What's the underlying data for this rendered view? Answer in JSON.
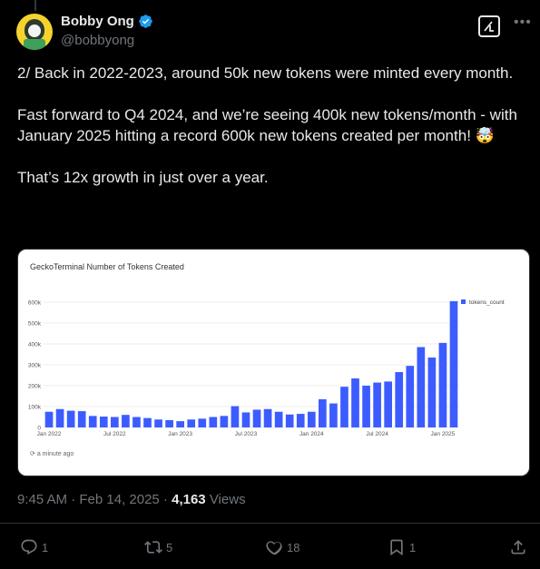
{
  "author": {
    "display_name": "Bobby Ong",
    "handle": "@bobbyong"
  },
  "tweet": {
    "text": "2/ Back in 2022-2023, around 50k new tokens were minted every month.\n\nFast forward to Q4 2024, and we’re seeing 400k new tokens/month - with January 2025 hitting a record 600k new tokens created per month! 🤯\n\nThat’s 12x growth in just over a year."
  },
  "chart_card": {
    "footer": "a minute ago"
  },
  "chart_data": {
    "type": "bar",
    "title": "GeckoTerminal Number of Tokens Created",
    "legend": "top-right",
    "grid": true,
    "xlabel": "",
    "ylabel": "",
    "ylim": [
      0,
      600000
    ],
    "y_ticks": [
      "0",
      "100k",
      "200k",
      "300k",
      "400k",
      "500k",
      "600k"
    ],
    "x_ticks": [
      "Jan 2022",
      "Jul 2022",
      "Jan 2023",
      "Jul 2023",
      "Jan 2024",
      "Jul 2024",
      "Jan 2025"
    ],
    "colors": {
      "bar": "#3d5cff"
    },
    "categories": [
      "Jan 2022",
      "Feb 2022",
      "Mar 2022",
      "Apr 2022",
      "May 2022",
      "Jun 2022",
      "Jul 2022",
      "Aug 2022",
      "Sep 2022",
      "Oct 2022",
      "Nov 2022",
      "Dec 2022",
      "Jan 2023",
      "Feb 2023",
      "Mar 2023",
      "Apr 2023",
      "May 2023",
      "Jun 2023",
      "Jul 2023",
      "Aug 2023",
      "Sep 2023",
      "Oct 2023",
      "Nov 2023",
      "Dec 2023",
      "Jan 2024",
      "Feb 2024",
      "Mar 2024",
      "Apr 2024",
      "May 2024",
      "Jun 2024",
      "Jul 2024",
      "Aug 2024",
      "Sep 2024",
      "Oct 2024",
      "Nov 2024",
      "Dec 2024",
      "Jan 2025"
    ],
    "series": [
      {
        "name": "tokens_count",
        "values": [
          75000,
          88000,
          80000,
          78000,
          55000,
          52000,
          50000,
          60000,
          50000,
          45000,
          38000,
          35000,
          30000,
          38000,
          42000,
          50000,
          55000,
          102000,
          72000,
          85000,
          88000,
          75000,
          62000,
          65000,
          75000,
          135000,
          115000,
          195000,
          235000,
          200000,
          215000,
          220000,
          265000,
          295000,
          385000,
          335000,
          405000,
          605000
        ]
      }
    ]
  },
  "meta": {
    "time": "9:45 AM · Feb 14, 2025 · ",
    "views": "4,163",
    "views_label": " Views"
  },
  "actions": {
    "replies": "1",
    "reposts": "5",
    "likes": "18",
    "bookmarks": "1"
  }
}
